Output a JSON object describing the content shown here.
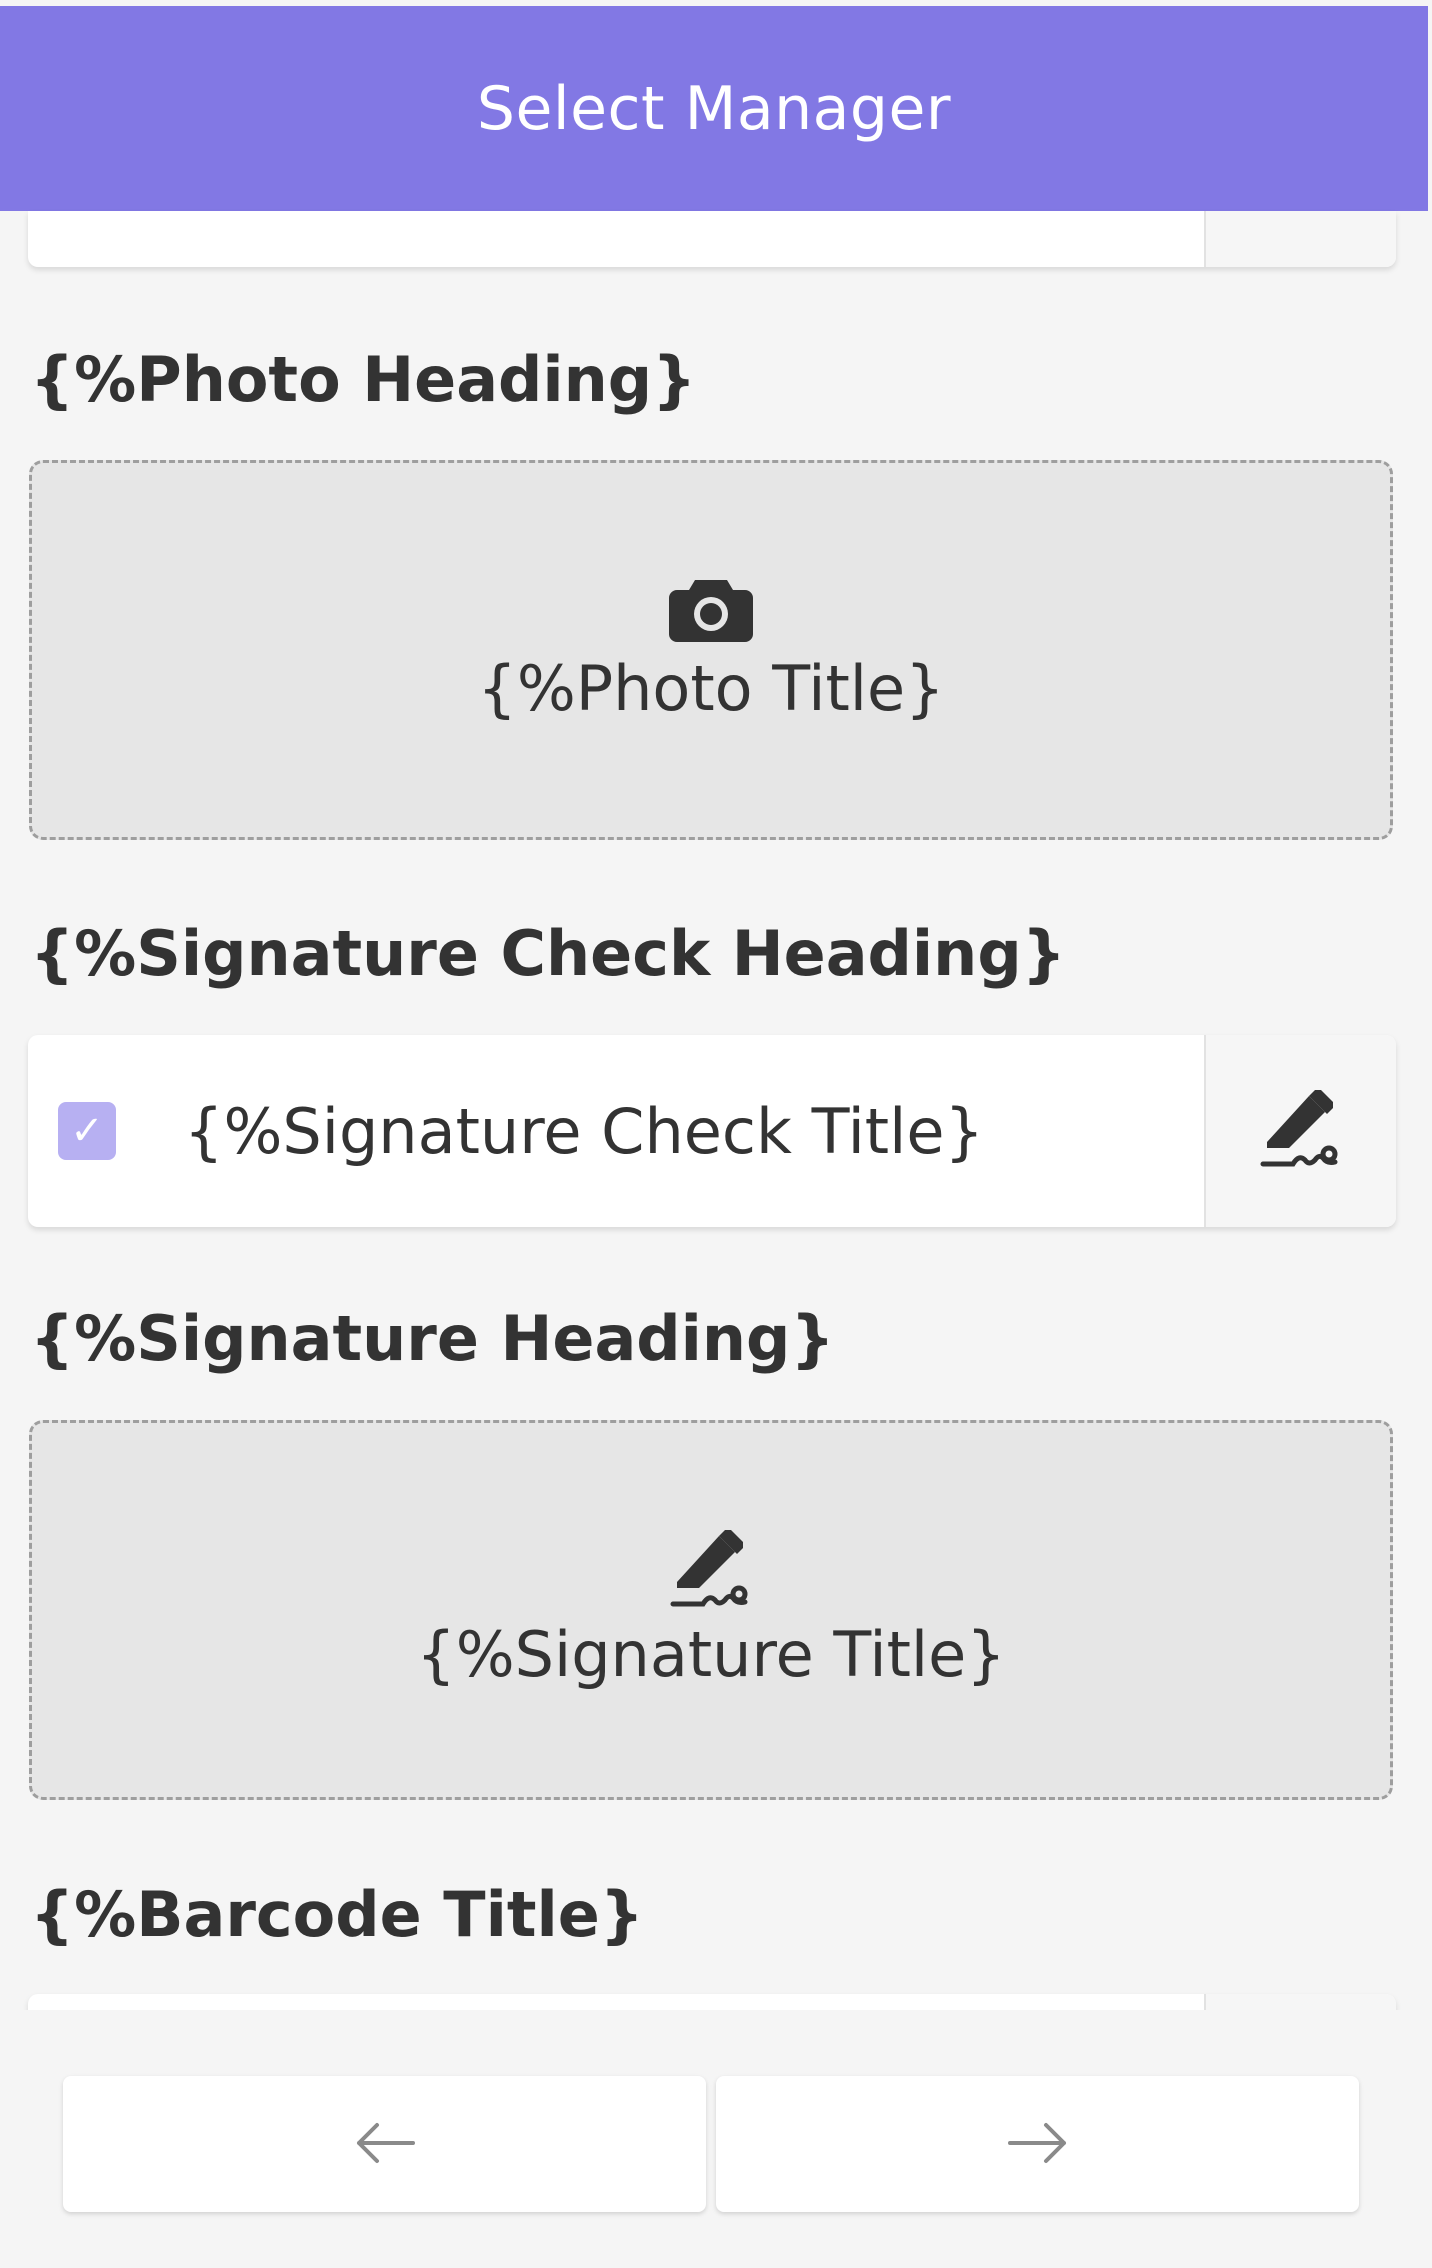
{
  "header": {
    "title": "Select Manager"
  },
  "photo": {
    "heading": "{%Photo Heading}",
    "title": "{%Photo Title}",
    "icon": "camera-icon"
  },
  "signature_check": {
    "heading": "{%Signature Check Heading}",
    "title": "{%Signature Check Title}",
    "checked": true,
    "icon": "signature-icon"
  },
  "signature": {
    "heading": "{%Signature Heading}",
    "title": "{%Signature Title}",
    "icon": "signature-icon"
  },
  "barcode": {
    "title": "{%Barcode Title}"
  },
  "nav": {
    "prev_icon": "arrow-left-icon",
    "next_icon": "arrow-right-icon"
  },
  "colors": {
    "accent": "#8278e4",
    "checkbox": "#b7b0f2"
  }
}
